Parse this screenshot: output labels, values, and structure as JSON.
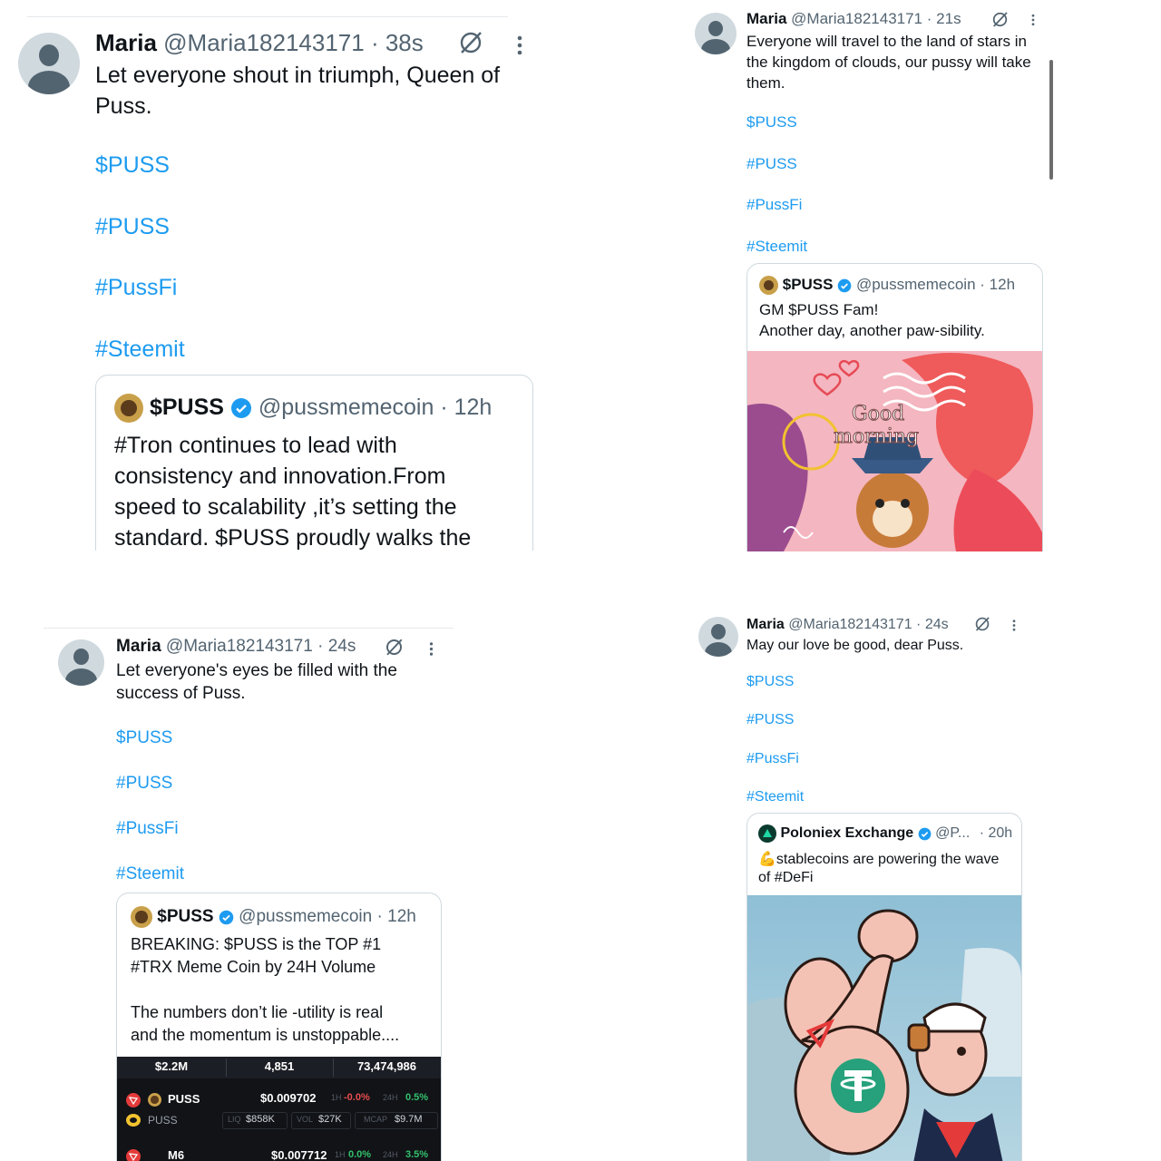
{
  "tweets": [
    {
      "name": "Maria",
      "handle": "@Maria182143171",
      "dot": "·",
      "time": "38s",
      "text": "Let everyone shout in triumph, Queen of Puss.",
      "tags": [
        "$PUSS",
        "#PUSS",
        "#PussFi",
        "#Steemit"
      ],
      "quote": {
        "name": "$PUSS",
        "handle": "@pussmemecoin",
        "time": "· 12h",
        "text": "#Tron continues to lead with consistency and innovation.From speed to scalability ,it’s setting the standard. $PUSS proudly walks the"
      }
    },
    {
      "name": "Maria",
      "handle": "@Maria182143171",
      "dot": "·",
      "time": "21s",
      "text": "Everyone will travel to the land of stars in the kingdom of clouds, our pussy will take them.",
      "tags": [
        "$PUSS",
        "#PUSS",
        "#PussFi",
        "#Steemit"
      ],
      "quote": {
        "name": "$PUSS",
        "handle": "@pussmemecoin",
        "time": "· 12h",
        "text_line1": "GM $PUSS Fam!",
        "text_line2": "Another day, another paw-sibility.",
        "image_text_1": "Good",
        "image_text_2": "morning"
      }
    },
    {
      "name": "Maria",
      "handle": "@Maria182143171",
      "dot": "·",
      "time": "24s",
      "text": "Let everyone's eyes be filled with the success of Puss.",
      "tags": [
        "$PUSS",
        "#PUSS",
        "#PussFi",
        "#Steemit"
      ],
      "quote": {
        "name": "$PUSS",
        "handle": "@pussmemecoin",
        "time": "· 12h",
        "text_line1": "BREAKING: $PUSS is the TOP #1",
        "text_line2": "#TRX Meme Coin by 24H Volume",
        "text_line3": "The numbers don’t lie -utility is real",
        "text_line4": "and the momentum is unstoppable....",
        "stats": [
          "$2.2M",
          "4,851",
          "73,474,986"
        ],
        "token1": {
          "name": "PUSS",
          "sub": "PUSS",
          "price": "$0.009702",
          "h1_label": "1H",
          "h1": "-0.0%",
          "h24_label": "24H",
          "h24": "0.5%",
          "liq_label": "LIQ",
          "liq": "$858K",
          "vol_label": "VOL",
          "vol": "$27K",
          "mcap_label": "MCAP",
          "mcap": "$9.7M"
        },
        "token2": {
          "name": "M6",
          "price": "$0.007712",
          "h1_label": "1H",
          "h1": "0.0%",
          "h24_label": "24H",
          "h24": "3.5%"
        }
      }
    },
    {
      "name": "Maria",
      "handle": "@Maria182143171",
      "dot": "·",
      "time": "24s",
      "text": "May our love be good, dear Puss.",
      "tags": [
        "$PUSS",
        "#PUSS",
        "#PussFi",
        "#Steemit"
      ],
      "quote": {
        "name": "Poloniex Exchange",
        "handle": "@P...",
        "time": "· 20h",
        "text_line1": "💪stablecoins are powering the wave",
        "text_line2": "of #DeFi"
      }
    }
  ],
  "colors": {
    "link": "#1d9bf0",
    "muted": "#536471",
    "text": "#0f1419",
    "verified": "#1d9bf0"
  },
  "icons": [
    "grok-icon",
    "more-icon",
    "verified-icon",
    "avatar-default"
  ]
}
